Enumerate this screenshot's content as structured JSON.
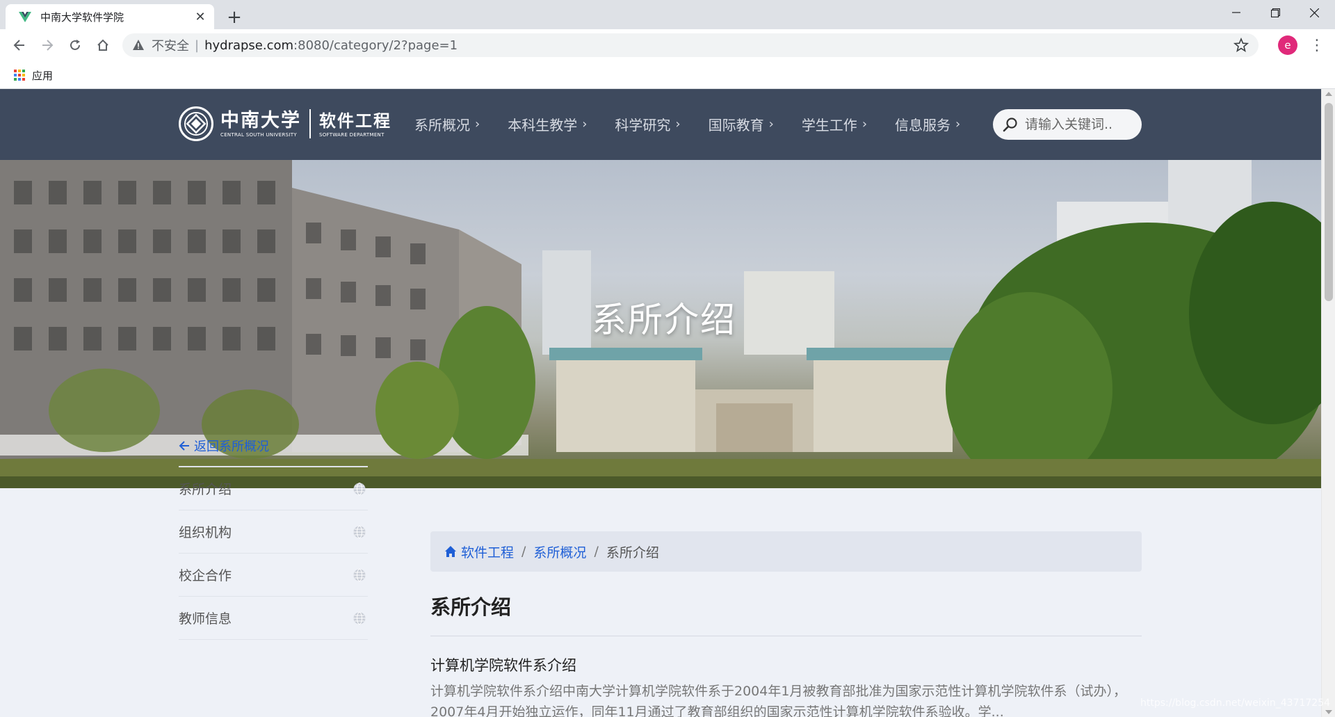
{
  "browser": {
    "tab_title": "中南大学软件学院",
    "omnibox": {
      "security_label": "不安全",
      "separator": "|",
      "url_host": "hydrapse.com",
      "url_path": ":8080/category/2?page=1"
    },
    "profile_initial": "e",
    "bookmarks": {
      "apps_label": "应用"
    },
    "colors": {
      "profile": "#e0297a",
      "tab_favicon": "#41b883"
    }
  },
  "site": {
    "logo": {
      "university_cn": "中南大学",
      "university_en": "CENTRAL SOUTH UNIVERSITY",
      "department_cn": "软件工程",
      "department_en": "SOFTWARE DEPARTMENT"
    },
    "nav": [
      {
        "label": "系所概况",
        "chevron": "›"
      },
      {
        "label": "本科生教学",
        "chevron": "›"
      },
      {
        "label": "科学研究",
        "chevron": "›"
      },
      {
        "label": "国际教育",
        "chevron": "›"
      },
      {
        "label": "学生工作",
        "chevron": "›"
      },
      {
        "label": "信息服务",
        "chevron": "›"
      }
    ],
    "search": {
      "placeholder": "请输入关键词.."
    },
    "hero_title": "系所介绍",
    "sidebar": {
      "back_label": "返回系所概况",
      "items": [
        {
          "label": "系所介绍"
        },
        {
          "label": "组织机构"
        },
        {
          "label": "校企合作"
        },
        {
          "label": "教师信息"
        }
      ]
    },
    "breadcrumb": {
      "home": "软件工程",
      "sep": "/",
      "parent": "系所概况",
      "current": "系所介绍"
    },
    "page_title": "系所介绍",
    "article": {
      "title": "计算机学院软件系介绍",
      "excerpt": "计算机学院软件系介绍中南大学计算机学院软件系于2004年1月被教育部批准为国家示范性计算机学院软件系（试办），2007年4月开始独立运作，同年11月通过了教育部组织的国家示范性计算机学院软件系验收。学..."
    },
    "watermark": "https://blog.csdn.net/weixin_43717254",
    "colors": {
      "header_bg": "#3e4a5e",
      "link": "#1f5fd6",
      "page_bg": "#eef1f7",
      "breadcrumb_bg": "#e1e5ee"
    }
  }
}
